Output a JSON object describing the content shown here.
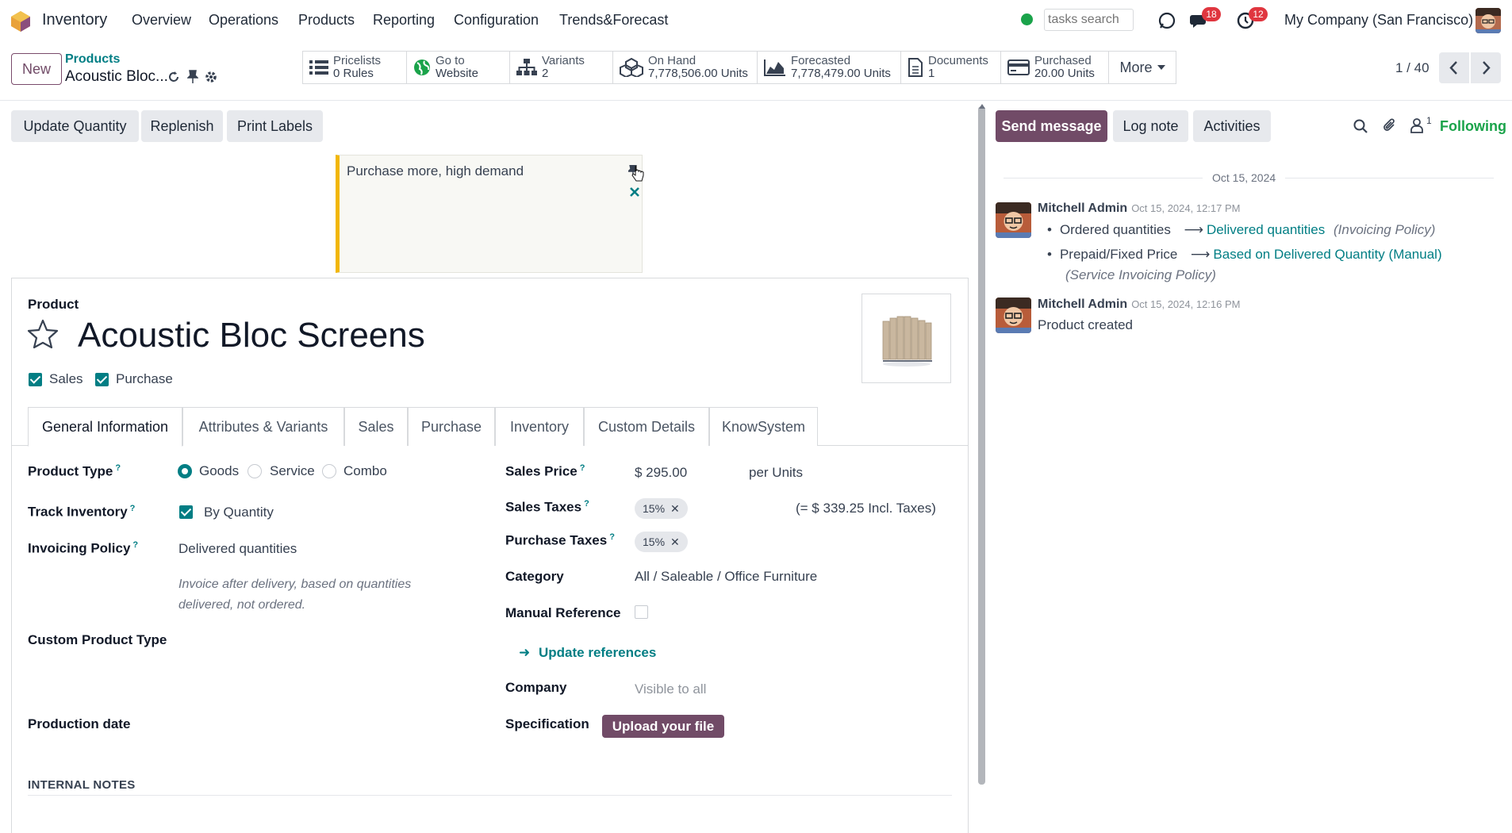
{
  "navbar": {
    "app_name": "Inventory",
    "menu": [
      "Overview",
      "Operations",
      "Products",
      "Reporting",
      "Configuration",
      "Trends&Forecast"
    ],
    "search_placeholder": "tasks search",
    "messages_count": "18",
    "activities_count": "12",
    "company": "My Company (San Francisco)",
    "presence_color": "#1aa34a"
  },
  "control_panel": {
    "new_label": "New",
    "breadcrumb_parent": "Products",
    "breadcrumb_current": "Acoustic Bloc...",
    "pager": "1 / 40",
    "stats": [
      {
        "icon": "list-icon",
        "title": "Pricelists",
        "value": "0 Rules"
      },
      {
        "icon": "globe-icon",
        "title": "Go to",
        "value": "Website"
      },
      {
        "icon": "sitemap-icon",
        "title": "Variants",
        "value": "2"
      },
      {
        "icon": "cubes-icon",
        "title": "On Hand",
        "value": "7,778,506.00 Units"
      },
      {
        "icon": "area-chart-icon",
        "title": "Forecasted",
        "value": "7,778,479.00 Units"
      },
      {
        "icon": "document-icon",
        "title": "Documents",
        "value": "1"
      },
      {
        "icon": "credit-card-icon",
        "title": "Purchased",
        "value": "20.00 Units"
      }
    ],
    "more_label": "More"
  },
  "actions": [
    "Update Quantity",
    "Replenish",
    "Print Labels"
  ],
  "sticky_note": "Purchase more, high demand",
  "product": {
    "type_label": "Product",
    "name": "Acoustic Bloc Screens",
    "sales_label": "Sales",
    "purchase_label": "Purchase"
  },
  "tabs": [
    "General Information",
    "Attributes & Variants",
    "Sales",
    "Purchase",
    "Inventory",
    "Custom Details",
    "KnowSystem"
  ],
  "form": {
    "product_type_label": "Product Type",
    "product_type_options": [
      "Goods",
      "Service",
      "Combo"
    ],
    "product_type_selected": "Goods",
    "track_inventory_label": "Track Inventory",
    "track_inventory_value": "By Quantity",
    "invoicing_policy_label": "Invoicing Policy",
    "invoicing_policy_value": "Delivered quantities",
    "invoicing_policy_help_1": "Invoice after delivery, based on quantities",
    "invoicing_policy_help_2": "delivered, not ordered.",
    "custom_product_type_label": "Custom Product Type",
    "production_date_label": "Production date",
    "sales_price_label": "Sales Price",
    "sales_price_value": "$ 295.00",
    "sales_price_unit": "per Units",
    "sales_taxes_label": "Sales Taxes",
    "sales_taxes_tag": "15%",
    "sales_taxes_incl": "(= $ 339.25 Incl. Taxes)",
    "purchase_taxes_label": "Purchase Taxes",
    "purchase_taxes_tag": "15%",
    "category_label": "Category",
    "category_value": "All / Saleable / Office Furniture",
    "manual_reference_label": "Manual Reference",
    "update_references_label": "Update references",
    "company_label": "Company",
    "company_placeholder": "Visible to all",
    "specification_label": "Specification",
    "upload_label": "Upload your file",
    "internal_notes_label": "INTERNAL NOTES"
  },
  "chatter": {
    "send_message": "Send message",
    "log_note": "Log note",
    "activities": "Activities",
    "followers_count": "1",
    "following": "Following",
    "date_separator": "Oct 15, 2024",
    "messages": [
      {
        "author": "Mitchell Admin",
        "date": "Oct 15, 2024, 12:17 PM",
        "changes": [
          {
            "old": "Ordered quantities",
            "new": "Delivered quantities",
            "field": "(Invoicing Policy)"
          },
          {
            "old": "Prepaid/Fixed Price",
            "new": "Based on Delivered Quantity (Manual)",
            "field": "(Service Invoicing Policy)"
          }
        ]
      },
      {
        "author": "Mitchell Admin",
        "date": "Oct 15, 2024, 12:16 PM",
        "body": "Product created"
      }
    ]
  },
  "colors": {
    "brand": "#714b67",
    "accent": "#017e84",
    "badge": "#e0363f"
  }
}
